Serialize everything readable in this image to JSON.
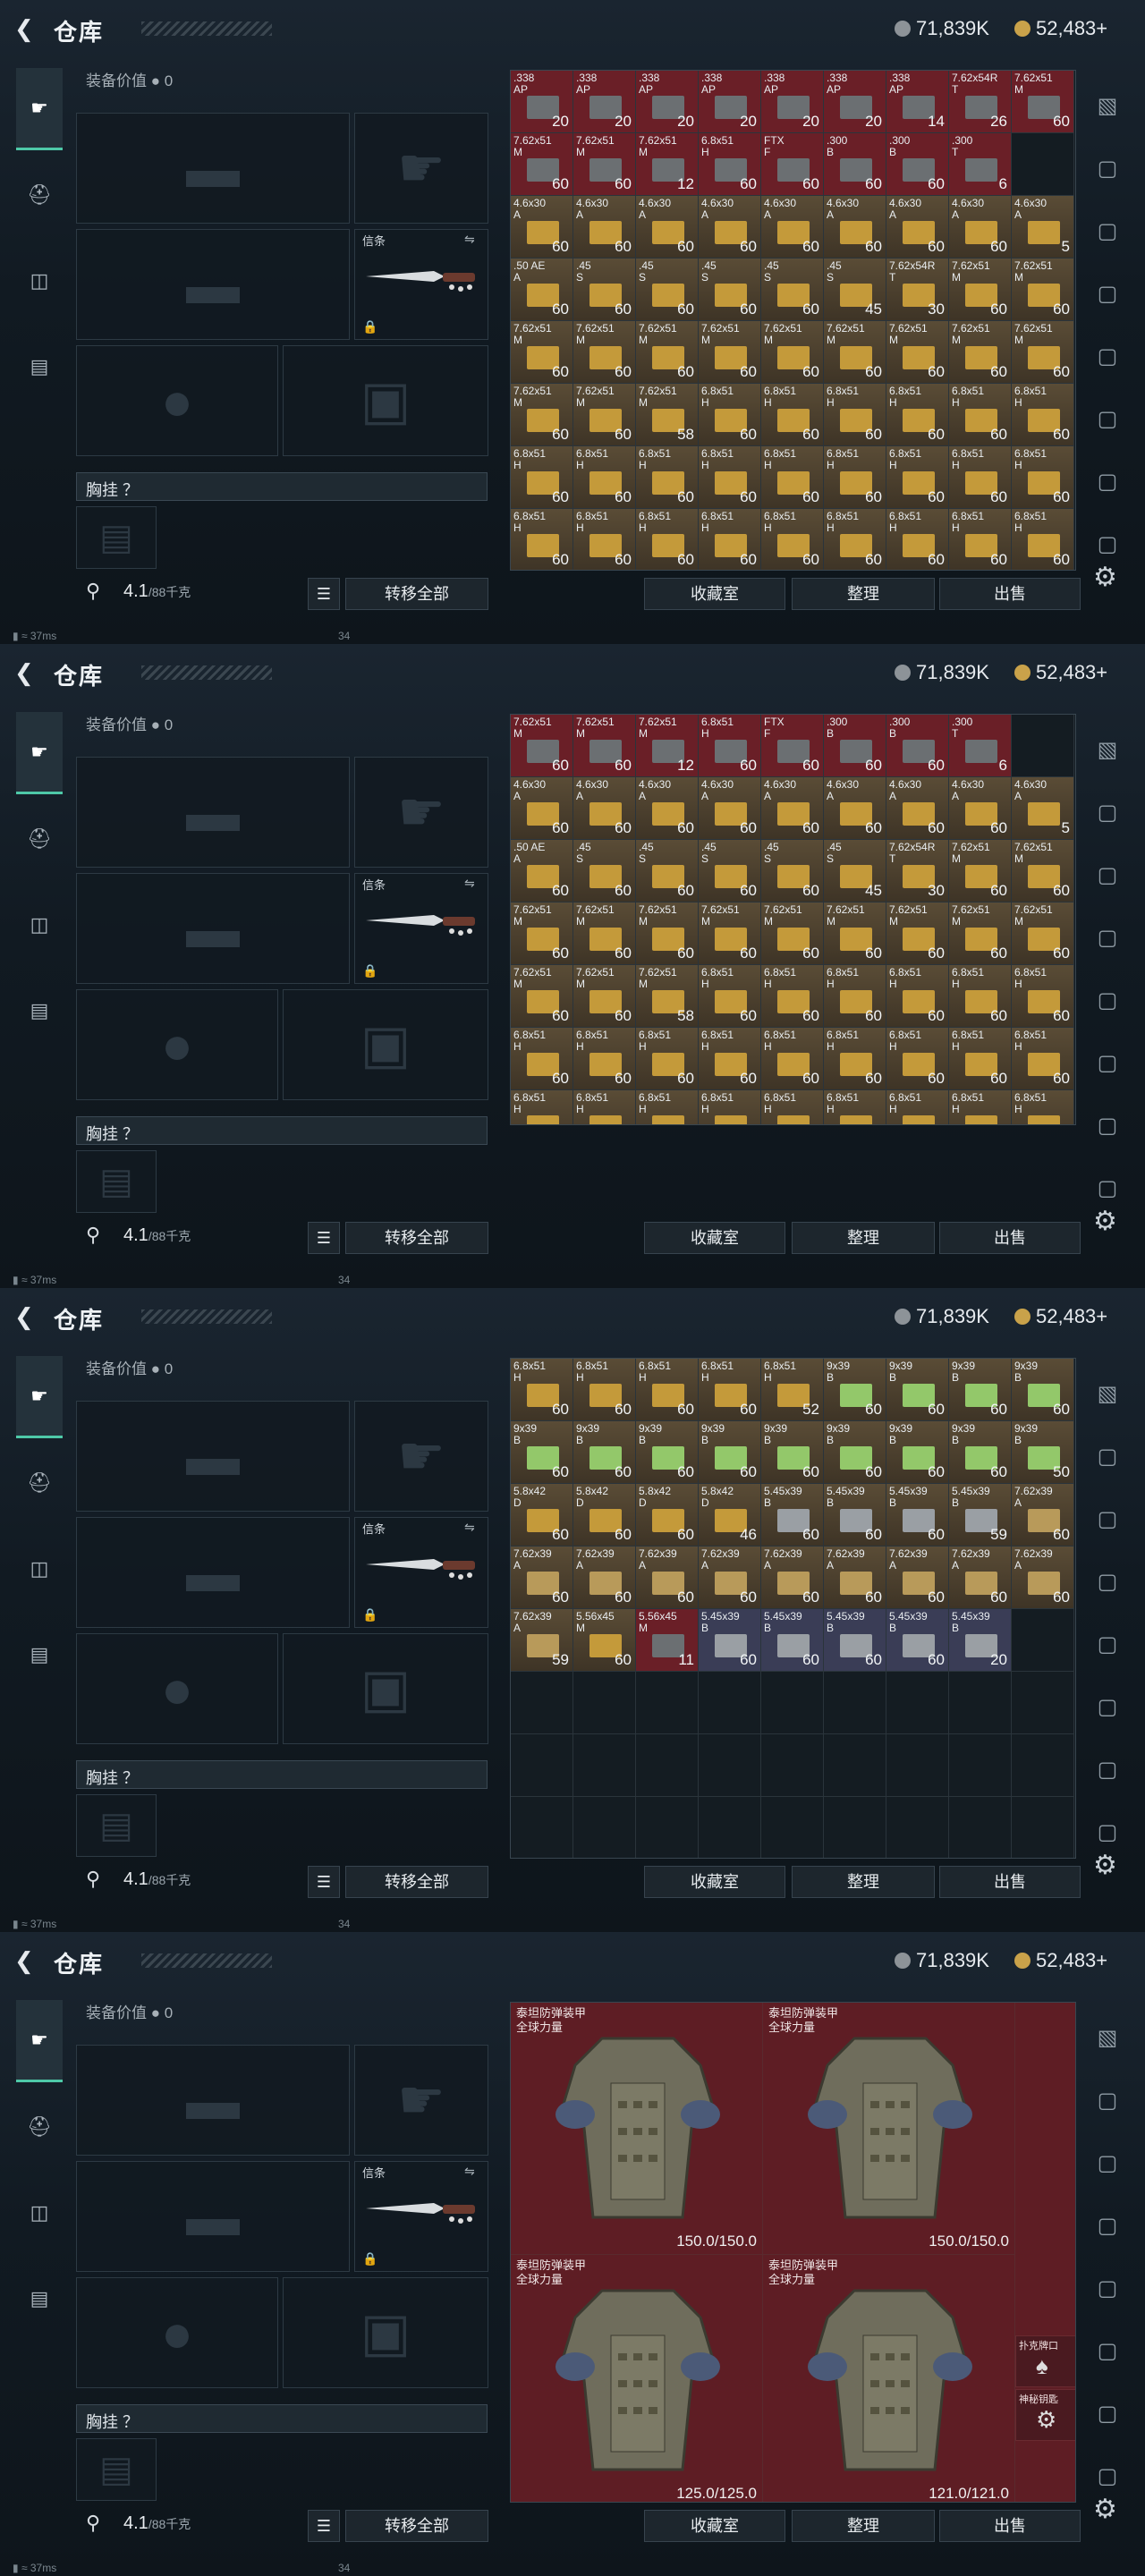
{
  "header": {
    "title": "仓库",
    "currency1": "71,839K",
    "currency2": "52,483+"
  },
  "equipment": {
    "value_label": "装备价值",
    "value": "0",
    "knife_label": "信条",
    "chest_label": "胸挂 ？",
    "weight": "4.1",
    "weight_max": "/88千克",
    "transfer_all": "转移全部"
  },
  "buttons": {
    "collection": "收藏室",
    "organize": "整理",
    "sell": "出售"
  },
  "status": {
    "ping": "37ms",
    "number": "34"
  },
  "colors": {
    "red_bg": "#6a1f27",
    "brown_bg": "#4a3f31",
    "panel": "#141c22"
  },
  "panel1_rows": [
    [
      [
        ".338\nAP",
        "20",
        "r"
      ],
      [
        ".338\nAP",
        "20",
        "r"
      ],
      [
        ".338\nAP",
        "20",
        "r"
      ],
      [
        ".338\nAP",
        "20",
        "r"
      ],
      [
        ".338\nAP",
        "20",
        "r"
      ],
      [
        ".338\nAP",
        "20",
        "r"
      ],
      [
        ".338\nAP",
        "14",
        "r"
      ],
      [
        "7.62x54R\nT",
        "26",
        "r"
      ],
      [
        "7.62x51\nM",
        "60",
        "r"
      ]
    ],
    [
      [
        "7.62x51\nM",
        "60",
        "r"
      ],
      [
        "7.62x51\nM",
        "60",
        "r"
      ],
      [
        "7.62x51\nM",
        "12",
        "r"
      ],
      [
        "6.8x51\nH",
        "60",
        "r"
      ],
      [
        "FTX\nF",
        "60",
        "r"
      ],
      [
        ".300\nB",
        "60",
        "r"
      ],
      [
        ".300\nB",
        "60",
        "r"
      ],
      [
        ".300\nT",
        "6",
        "r"
      ],
      [
        "",
        ""
      ]
    ],
    [
      [
        "4.6x30\nA",
        "60",
        "b"
      ],
      [
        "4.6x30\nA",
        "60",
        "b"
      ],
      [
        "4.6x30\nA",
        "60",
        "b"
      ],
      [
        "4.6x30\nA",
        "60",
        "b"
      ],
      [
        "4.6x30\nA",
        "60",
        "b"
      ],
      [
        "4.6x30\nA",
        "60",
        "b"
      ],
      [
        "4.6x30\nA",
        "60",
        "b"
      ],
      [
        "4.6x30\nA",
        "60",
        "b"
      ],
      [
        "4.6x30\nA",
        "5",
        "b"
      ]
    ],
    [
      [
        ".50 AE\nA",
        "60",
        "b"
      ],
      [
        ".45\nS",
        "60",
        "b"
      ],
      [
        ".45\nS",
        "60",
        "b"
      ],
      [
        ".45\nS",
        "60",
        "b"
      ],
      [
        ".45\nS",
        "60",
        "b"
      ],
      [
        ".45\nS",
        "45",
        "b"
      ],
      [
        "7.62x54R\nT",
        "30",
        "b"
      ],
      [
        "7.62x51\nM",
        "60",
        "b"
      ],
      [
        "7.62x51\nM",
        "60",
        "b"
      ]
    ],
    [
      [
        "7.62x51\nM",
        "60",
        "b"
      ],
      [
        "7.62x51\nM",
        "60",
        "b"
      ],
      [
        "7.62x51\nM",
        "60",
        "b"
      ],
      [
        "7.62x51\nM",
        "60",
        "b"
      ],
      [
        "7.62x51\nM",
        "60",
        "b"
      ],
      [
        "7.62x51\nM",
        "60",
        "b"
      ],
      [
        "7.62x51\nM",
        "60",
        "b"
      ],
      [
        "7.62x51\nM",
        "60",
        "b"
      ],
      [
        "7.62x51\nM",
        "60",
        "b"
      ]
    ],
    [
      [
        "7.62x51\nM",
        "60",
        "b"
      ],
      [
        "7.62x51\nM",
        "60",
        "b"
      ],
      [
        "7.62x51\nM",
        "58",
        "b"
      ],
      [
        "6.8x51\nH",
        "60",
        "b"
      ],
      [
        "6.8x51\nH",
        "60",
        "b"
      ],
      [
        "6.8x51\nH",
        "60",
        "b"
      ],
      [
        "6.8x51\nH",
        "60",
        "b"
      ],
      [
        "6.8x51\nH",
        "60",
        "b"
      ],
      [
        "6.8x51\nH",
        "60",
        "b"
      ]
    ],
    [
      [
        "6.8x51\nH",
        "60",
        "b"
      ],
      [
        "6.8x51\nH",
        "60",
        "b"
      ],
      [
        "6.8x51\nH",
        "60",
        "b"
      ],
      [
        "6.8x51\nH",
        "60",
        "b"
      ],
      [
        "6.8x51\nH",
        "60",
        "b"
      ],
      [
        "6.8x51\nH",
        "60",
        "b"
      ],
      [
        "6.8x51\nH",
        "60",
        "b"
      ],
      [
        "6.8x51\nH",
        "60",
        "b"
      ],
      [
        "6.8x51\nH",
        "60",
        "b"
      ]
    ],
    [
      [
        "6.8x51\nH",
        "60",
        "b"
      ],
      [
        "6.8x51\nH",
        "60",
        "b"
      ],
      [
        "6.8x51\nH",
        "60",
        "b"
      ],
      [
        "6.8x51\nH",
        "60",
        "b"
      ],
      [
        "6.8x51\nH",
        "60",
        "b"
      ],
      [
        "6.8x51\nH",
        "60",
        "b"
      ],
      [
        "6.8x51\nH",
        "60",
        "b"
      ],
      [
        "6.8x51\nH",
        "60",
        "b"
      ],
      [
        "6.8x51\nH",
        "60",
        "b"
      ]
    ]
  ],
  "panel3_rows": [
    [
      [
        "6.8x51\nH",
        "60",
        "b"
      ],
      [
        "6.8x51\nH",
        "60",
        "b"
      ],
      [
        "6.8x51\nH",
        "60",
        "b"
      ],
      [
        "6.8x51\nH",
        "60",
        "b"
      ],
      [
        "6.8x51\nH",
        "52",
        "b"
      ],
      [
        "9x39\nB",
        "60",
        "b"
      ],
      [
        "9x39\nB",
        "60",
        "b"
      ],
      [
        "9x39\nB",
        "60",
        "b"
      ],
      [
        "9x39\nB",
        "60",
        "b"
      ]
    ],
    [
      [
        "9x39\nB",
        "60",
        "b"
      ],
      [
        "9x39\nB",
        "60",
        "b"
      ],
      [
        "9x39\nB",
        "60",
        "b"
      ],
      [
        "9x39\nB",
        "60",
        "b"
      ],
      [
        "9x39\nB",
        "60",
        "b"
      ],
      [
        "9x39\nB",
        "60",
        "b"
      ],
      [
        "9x39\nB",
        "60",
        "b"
      ],
      [
        "9x39\nB",
        "60",
        "b"
      ],
      [
        "9x39\nB",
        "50",
        "b"
      ]
    ],
    [
      [
        "5.8x42\nD",
        "60",
        "b"
      ],
      [
        "5.8x42\nD",
        "60",
        "b"
      ],
      [
        "5.8x42\nD",
        "60",
        "b"
      ],
      [
        "5.8x42\nD",
        "46",
        "b"
      ],
      [
        "5.45x39\nB",
        "60",
        "b"
      ],
      [
        "5.45x39\nB",
        "60",
        "b"
      ],
      [
        "5.45x39\nB",
        "60",
        "b"
      ],
      [
        "5.45x39\nB",
        "59",
        "b"
      ],
      [
        "7.62x39\nA",
        "60",
        "b"
      ]
    ],
    [
      [
        "7.62x39\nA",
        "60",
        "b"
      ],
      [
        "7.62x39\nA",
        "60",
        "b"
      ],
      [
        "7.62x39\nA",
        "60",
        "b"
      ],
      [
        "7.62x39\nA",
        "60",
        "b"
      ],
      [
        "7.62x39\nA",
        "60",
        "b"
      ],
      [
        "7.62x39\nA",
        "60",
        "b"
      ],
      [
        "7.62x39\nA",
        "60",
        "b"
      ],
      [
        "7.62x39\nA",
        "60",
        "b"
      ],
      [
        "7.62x39\nA",
        "60",
        "b"
      ]
    ],
    [
      [
        "7.62x39\nA",
        "59",
        "b"
      ],
      [
        "5.56x45\nM",
        "60",
        "b"
      ],
      [
        "5.56x45\nM",
        "11",
        "r"
      ],
      [
        "5.45x39\nB",
        "60",
        "p"
      ],
      [
        "5.45x39\nB",
        "60",
        "p"
      ],
      [
        "5.45x39\nB",
        "60",
        "p"
      ],
      [
        "5.45x39\nB",
        "60",
        "p"
      ],
      [
        "5.45x39\nB",
        "20",
        "p"
      ],
      [
        "",
        ""
      ]
    ]
  ],
  "armor": [
    {
      "name": "泰坦防弹装甲\n全球力量",
      "durability": "150.0/150.0"
    },
    {
      "name": "泰坦防弹装甲\n全球力量",
      "durability": "150.0/150.0"
    },
    {
      "name": "泰坦防弹装甲\n全球力量",
      "durability": "125.0/125.0"
    },
    {
      "name": "泰坦防弹装甲\n全球力量",
      "durability": "121.0/121.0"
    }
  ],
  "small_items": [
    {
      "name": "扑克牌口"
    },
    {
      "name": "神秘钥匙"
    }
  ]
}
